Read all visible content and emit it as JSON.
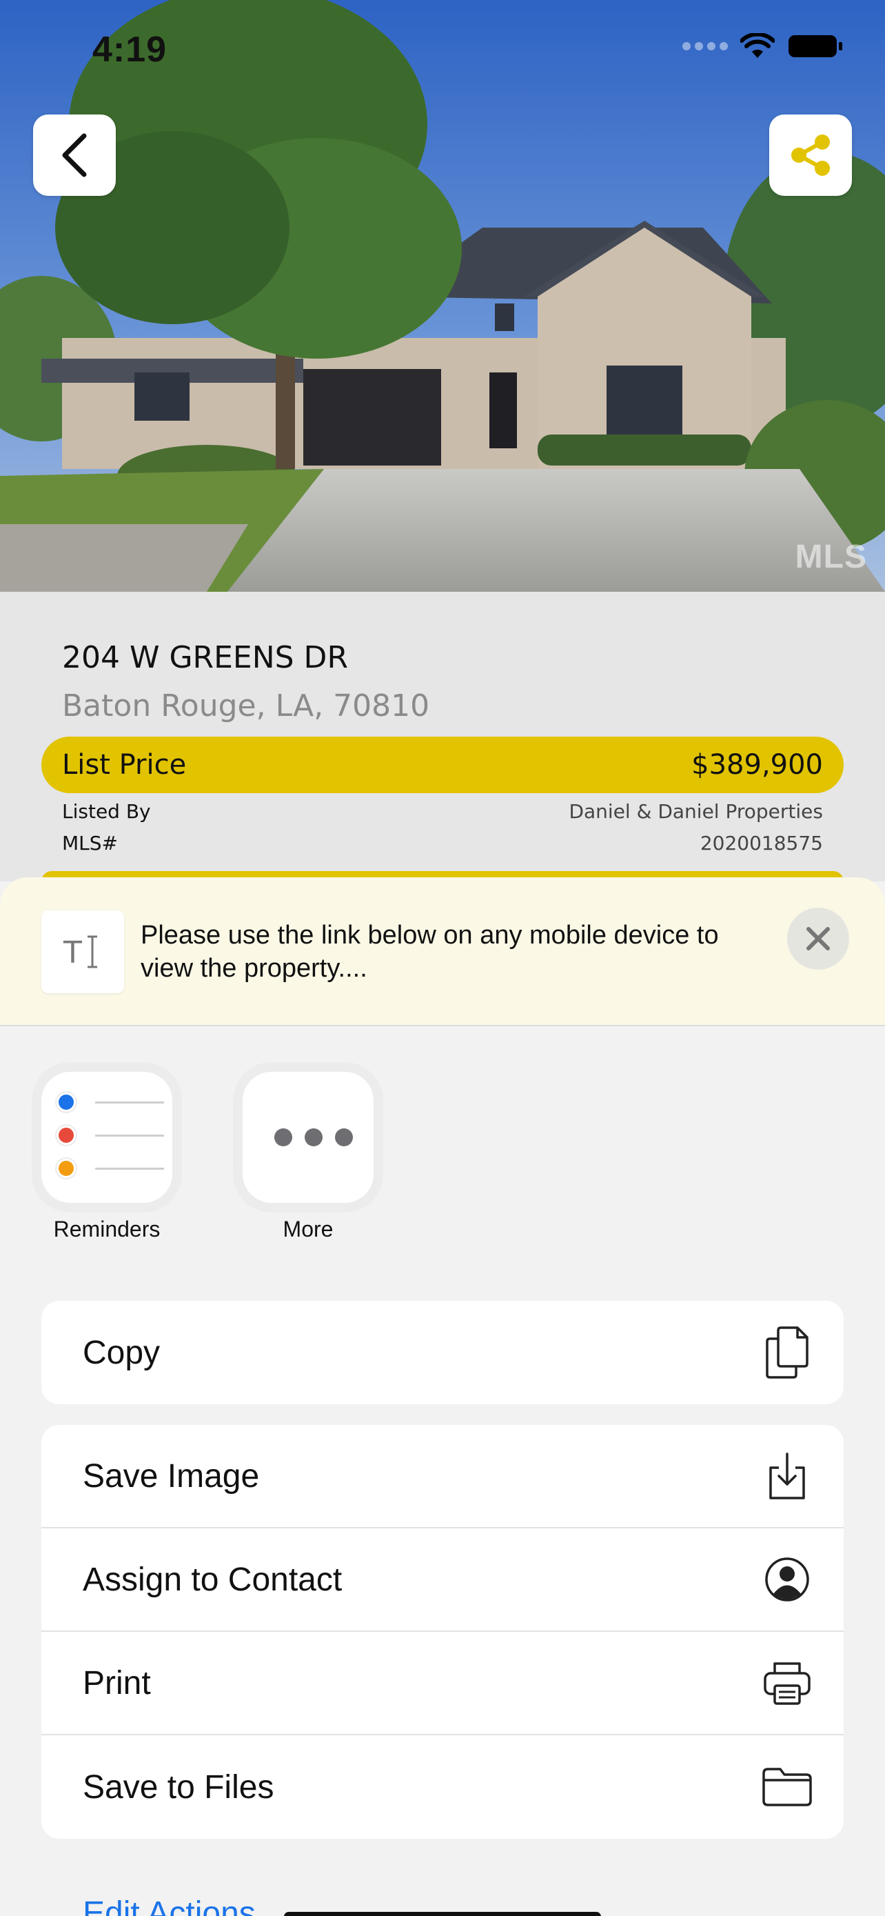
{
  "status_bar": {
    "time": "4:19"
  },
  "photo": {
    "watermark": "MLS"
  },
  "listing": {
    "address_line1": "204 W GREENS DR",
    "address_line2": "Baton Rouge, LA, 70810",
    "price_label": "List Price",
    "price_value": "$389,900",
    "listed_by_label": "Listed By",
    "listed_by_value": "Daniel & Daniel Properties",
    "mls_label": "MLS#",
    "mls_value": "2020018575"
  },
  "share_sheet": {
    "preview_text": "Please use the link below on any mobile device to view the property....",
    "apps": [
      {
        "label": "Reminders",
        "icon": "reminders-icon"
      },
      {
        "label": "More",
        "icon": "more-icon"
      }
    ],
    "actions": {
      "copy": "Copy",
      "save_image": "Save Image",
      "assign_contact": "Assign to Contact",
      "print": "Print",
      "save_files": "Save to Files"
    },
    "edit_actions": "Edit Actions..."
  },
  "colors": {
    "accent_yellow": "#e2c300",
    "link_blue": "#1a73e8",
    "sheet_header_bg": "#fbf8e6"
  }
}
